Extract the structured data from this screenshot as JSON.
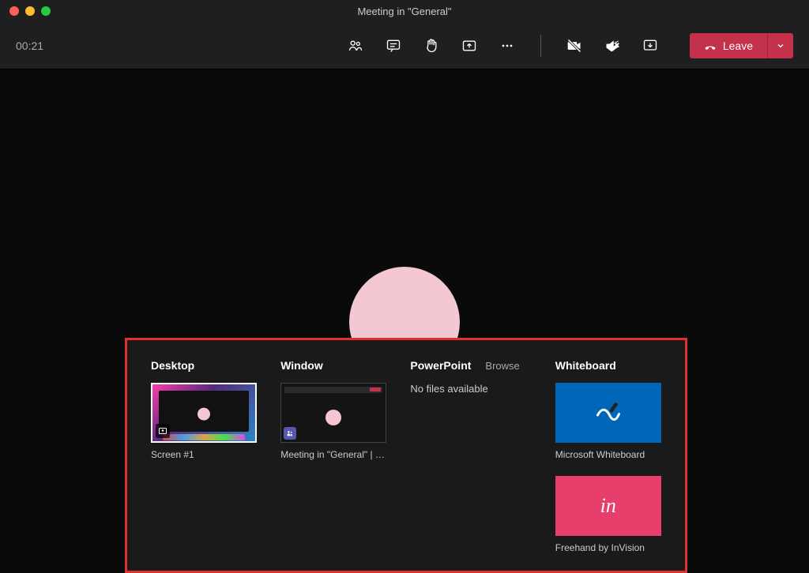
{
  "window": {
    "title": "Meeting in \"General\""
  },
  "toolbar": {
    "timer": "00:21",
    "leave_label": "Leave"
  },
  "share": {
    "headers": {
      "desktop": "Desktop",
      "window": "Window",
      "powerpoint": "PowerPoint",
      "browse": "Browse",
      "whiteboard": "Whiteboard"
    },
    "desktop_item": {
      "label": "Screen #1"
    },
    "window_item": {
      "label": "Meeting in \"General\" | M..."
    },
    "powerpoint_empty": "No files available",
    "whiteboard_items": {
      "ms": "Microsoft Whiteboard",
      "invision": "Freehand by InVision"
    }
  },
  "colors": {
    "accent": "#c4314b",
    "highlight_border": "#e03030"
  }
}
